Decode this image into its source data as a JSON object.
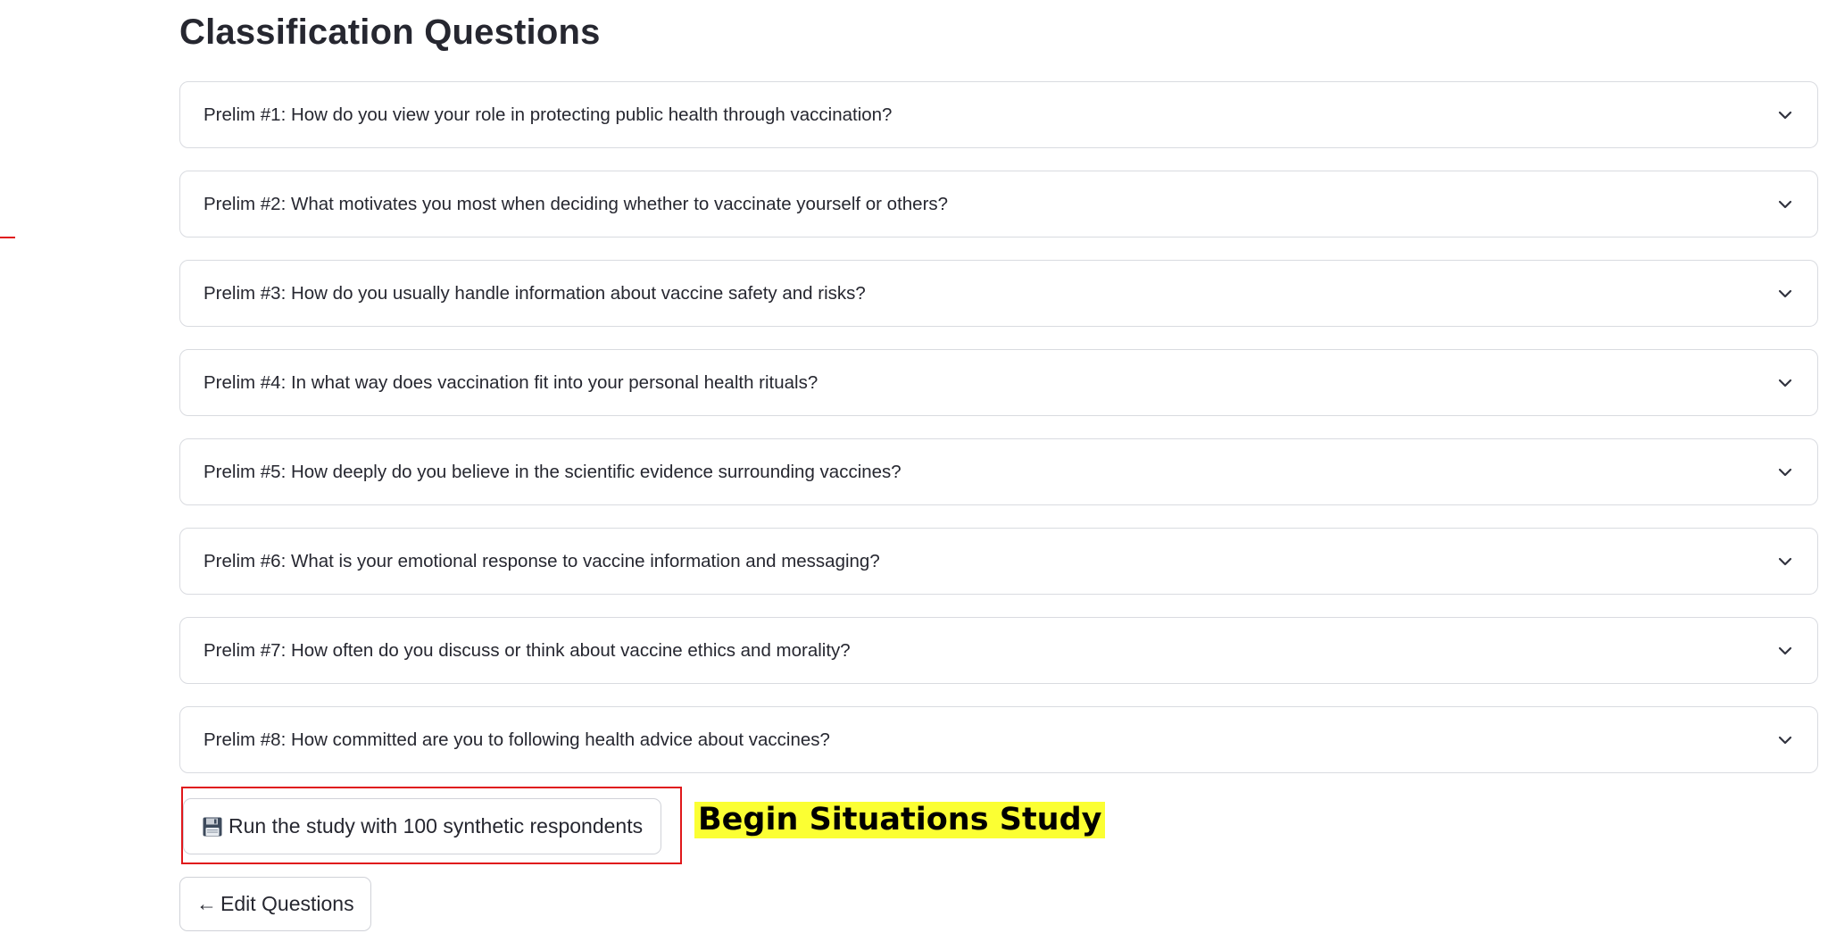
{
  "page": {
    "title": "Classification Questions"
  },
  "prelims": [
    {
      "label": "Prelim #1: How do you view your role in protecting public health through vaccination?"
    },
    {
      "label": "Prelim #2: What motivates you most when deciding whether to vaccinate yourself or others?"
    },
    {
      "label": "Prelim #3: How do you usually handle information about vaccine safety and risks?"
    },
    {
      "label": "Prelim #4: In what way does vaccination fit into your personal health rituals?"
    },
    {
      "label": "Prelim #5: How deeply do you believe in the scientific evidence surrounding vaccines?"
    },
    {
      "label": "Prelim #6: What is your emotional response to vaccine information and messaging?"
    },
    {
      "label": "Prelim #7: How often do you discuss or think about vaccine ethics and morality?"
    },
    {
      "label": "Prelim #8: How committed are you to following health advice about vaccines?"
    }
  ],
  "actions": {
    "run_label": "Run the study with 100 synthetic respondents",
    "run_icon": "floppy-disk-icon",
    "edit_arrow": "←",
    "edit_label": "Edit Questions"
  },
  "annotation": {
    "text": "Begin Situations Study",
    "highlight_color": "#fbff33",
    "box_color": "#e0181b"
  }
}
